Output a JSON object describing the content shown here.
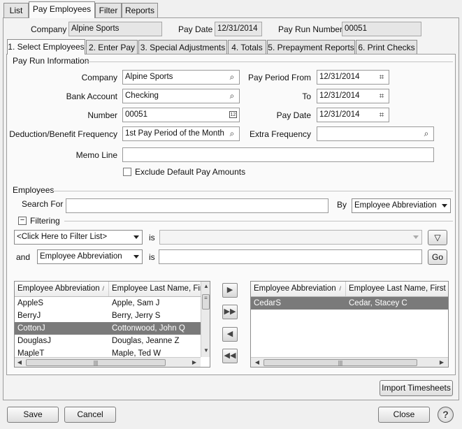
{
  "top_tabs": [
    "List",
    "Pay Employees",
    "Filter",
    "Reports"
  ],
  "header": {
    "company_label": "Company",
    "company_value": "Alpine Sports",
    "pay_date_label": "Pay Date",
    "pay_date_value": "12/31/2014",
    "pay_run_label": "Pay Run Number",
    "pay_run_value": "00051"
  },
  "step_tabs": [
    "1. Select Employees",
    "2. Enter Pay",
    "3. Special Adjustments",
    "4. Totals",
    "5. Prepayment Reports",
    "6. Print Checks"
  ],
  "pay_run": {
    "section_title": "Pay Run Information",
    "company_label": "Company",
    "company_value": "Alpine Sports",
    "bank_label": "Bank Account",
    "bank_value": "Checking",
    "number_label": "Number",
    "number_value": "00051",
    "freq_label": "Deduction/Benefit Frequency",
    "freq_value": "1st Pay Period of the Month",
    "memo_label": "Memo Line",
    "memo_value": "",
    "period_from_label": "Pay Period From",
    "period_from_value": "12/31/2014",
    "to_label": "To",
    "to_value": "12/31/2014",
    "pay_date_label": "Pay Date",
    "pay_date_value": "12/31/2014",
    "extra_label": "Extra Frequency",
    "extra_value": "",
    "exclude_label": "Exclude Default Pay Amounts"
  },
  "employees": {
    "section_title": "Employees",
    "search_label": "Search For",
    "search_value": "",
    "by_label": "By",
    "by_value": "Employee Abbreviation",
    "filtering_label": "Filtering",
    "filter1_value": "<Click Here to Filter List>",
    "is_label": "is",
    "and_label": "and",
    "filter2_value": "Employee Abbreviation",
    "go_label": "Go",
    "col_abbrev": "Employee Abbreviation",
    "col_last": "Employee Last Name, First Name",
    "available": [
      {
        "abbrev": "AppleS",
        "name": "Apple, Sam J"
      },
      {
        "abbrev": "BerryJ",
        "name": "Berry, Jerry S"
      },
      {
        "abbrev": "CottonJ",
        "name": "Cottonwood, John Q"
      },
      {
        "abbrev": "DouglasJ",
        "name": "Douglas, Jeanne Z"
      },
      {
        "abbrev": "MapleT",
        "name": "Maple, Ted W"
      }
    ],
    "selected": [
      {
        "abbrev": "CedarS",
        "name": "Cedar, Stacey C"
      }
    ],
    "import_label": "Import Timesheets"
  },
  "footer": {
    "save_label": "Save",
    "cancel_label": "Cancel",
    "close_label": "Close",
    "help_label": "?"
  }
}
